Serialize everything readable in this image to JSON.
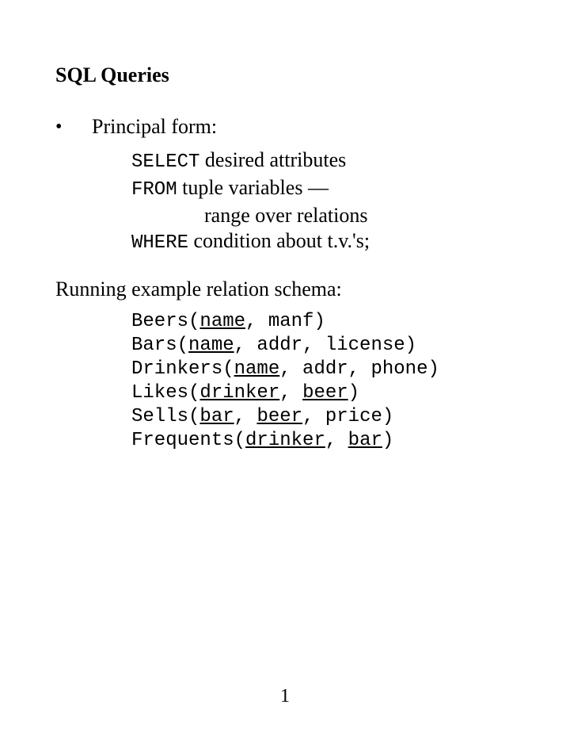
{
  "title": "SQL Queries",
  "bullet": "•",
  "principal_label": "Principal form:",
  "form": {
    "select_kw": "SELECT",
    "select_rest": " desired attributes",
    "from_kw": "FROM",
    "from_rest": " tuple variables —",
    "range": "range over relations",
    "where_kw": "WHERE",
    "where_rest": " condition about t.v.'s;"
  },
  "subhead": "Running example relation schema:",
  "schema": {
    "beers": {
      "rel": "Beers(",
      "k1": "name",
      "rest": ", manf)"
    },
    "bars": {
      "rel": "Bars(",
      "k1": "name",
      "rest": ", addr, license)"
    },
    "drinkers": {
      "rel": "Drinkers(",
      "k1": "name",
      "rest": ", addr, phone)"
    },
    "likes": {
      "rel": "Likes(",
      "k1": "drinker",
      "sep": ", ",
      "k2": "beer",
      "rest": ")"
    },
    "sells": {
      "rel": "Sells(",
      "k1": "bar",
      "sep": ", ",
      "k2": "beer",
      "rest": ", price)"
    },
    "frequents": {
      "rel": "Frequents(",
      "k1": "drinker",
      "sep": ", ",
      "k2": "bar",
      "rest": ")"
    }
  },
  "page_number": "1"
}
